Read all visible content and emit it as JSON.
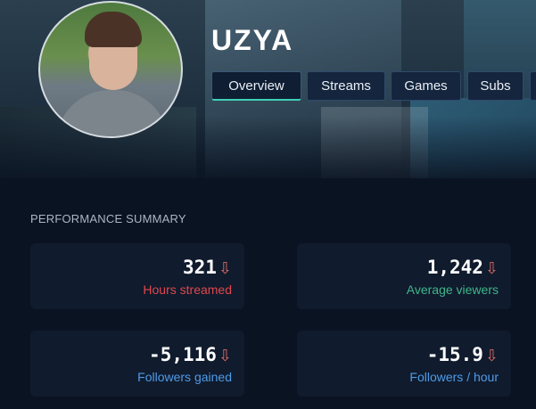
{
  "channel": {
    "name": "UZYA"
  },
  "tabs": [
    {
      "label": "Overview",
      "active": true
    },
    {
      "label": "Streams"
    },
    {
      "label": "Games"
    },
    {
      "label": "Subs"
    }
  ],
  "section_title": "PERFORMANCE SUMMARY",
  "stats": [
    {
      "value": "321",
      "label": "Hours streamed",
      "label_color": "#e0474c",
      "trend": "down"
    },
    {
      "value": "1,242",
      "label": "Average viewers",
      "label_color": "#3fb68b",
      "trend": "down"
    },
    {
      "value": "-5,116",
      "label": "Followers gained",
      "label_color": "#4f9be8",
      "trend": "down"
    },
    {
      "value": "-15.9",
      "label": "Followers / hour",
      "label_color": "#4f9be8",
      "trend": "down"
    }
  ],
  "icons": {
    "trend_down": "arrow-down-icon"
  },
  "colors": {
    "accent": "#3fd1b5",
    "trend_down": "#d76a63"
  }
}
